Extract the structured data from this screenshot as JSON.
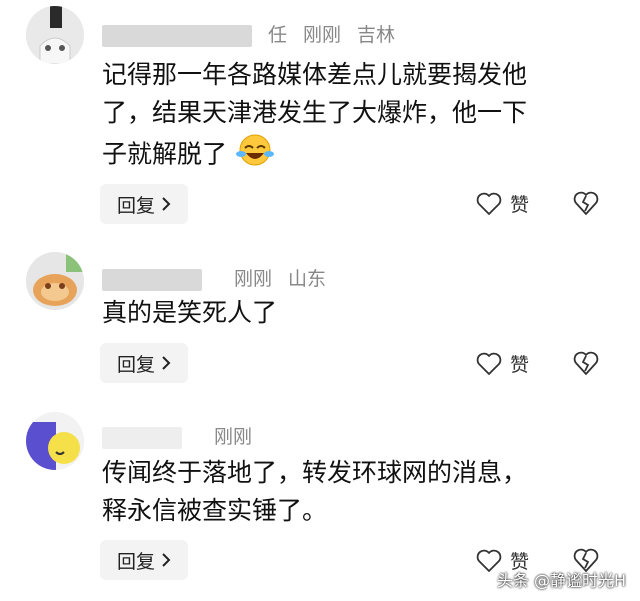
{
  "comments": [
    {
      "meta": {
        "name": "任",
        "time": "刚刚",
        "location": "吉林"
      },
      "text_lines": [
        "记得那一年各路媒体差点儿就要揭发他",
        "了，结果天津港发生了大爆炸，他一下",
        "子就解脱了"
      ],
      "emoji": "laughing-crying-emoji",
      "reply_label": "回复",
      "like_label": "赞"
    },
    {
      "meta": {
        "name": "",
        "time": "刚刚",
        "location": "山东"
      },
      "text_lines": [
        "真的是笑死人了"
      ],
      "reply_label": "回复",
      "like_label": "赞"
    },
    {
      "meta": {
        "name": "",
        "time": "刚刚",
        "location": ""
      },
      "text_lines": [
        "传闻终于落地了，转发环球网的消息，",
        "释永信被查实锤了。"
      ],
      "reply_label": "回复",
      "like_label": "赞"
    }
  ],
  "watermark": "头条 @静谧时光H",
  "icons": {
    "reply_chevron": "chevron-right-icon",
    "like": "heart-icon",
    "dislike": "broken-heart-icon"
  }
}
